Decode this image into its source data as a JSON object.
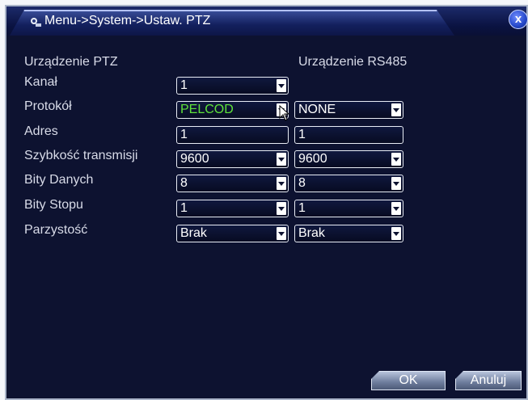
{
  "window": {
    "title": "Menu->System->Ustaw. PTZ",
    "close_label": "x"
  },
  "headers": {
    "ptz_device": "Urządzenie PTZ",
    "rs485_device": "Urządzenie RS485"
  },
  "rows": {
    "channel": {
      "label": "Kanał",
      "ptz": "1"
    },
    "protocol": {
      "label": "Protokół",
      "ptz": "PELCOD",
      "rs485": "NONE"
    },
    "address": {
      "label": "Adres",
      "ptz": "1",
      "rs485": "1"
    },
    "baud_rate": {
      "label": "Szybkość transmisji",
      "ptz": "9600",
      "rs485": "9600"
    },
    "data_bits": {
      "label": "Bity Danych",
      "ptz": "8",
      "rs485": "8"
    },
    "stop_bits": {
      "label": "Bity Stopu",
      "ptz": "1",
      "rs485": "1"
    },
    "parity": {
      "label": "Parzystość",
      "ptz": "Brak",
      "rs485": "Brak"
    }
  },
  "buttons": {
    "ok": "OK",
    "cancel": "Anuluj"
  },
  "colors": {
    "background": "#0d1230",
    "protocol_value": "#5fe23a"
  }
}
